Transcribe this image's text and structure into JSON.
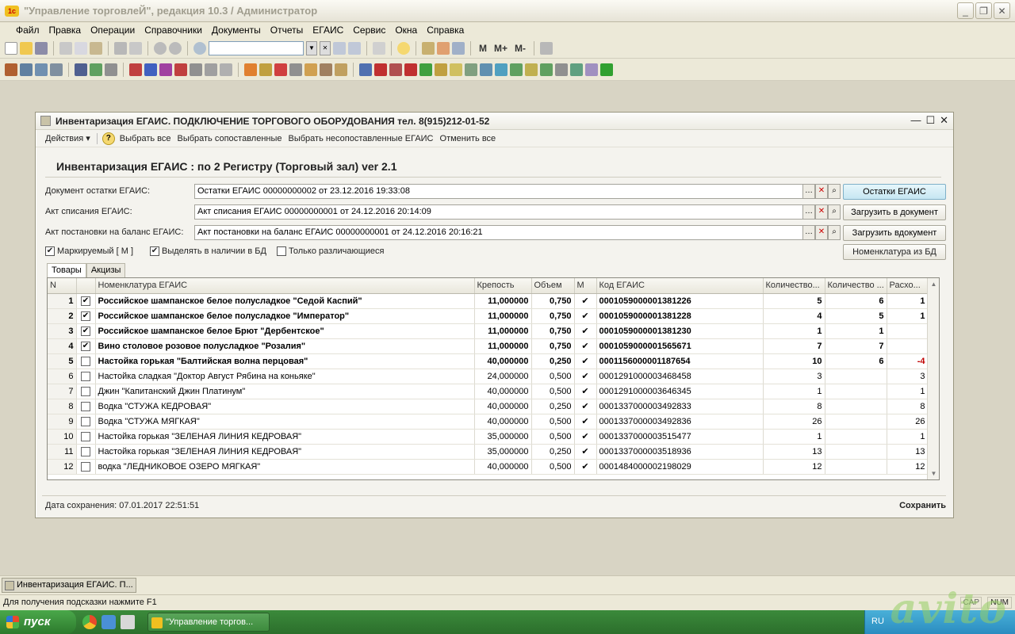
{
  "app": {
    "title": "\"Управление торговлеЙ\", редакция 10.3 / Администратор",
    "menu": [
      "Файл",
      "Правка",
      "Операции",
      "Справочники",
      "Документы",
      "Отчеты",
      "ЕГАИС",
      "Сервис",
      "Окна",
      "Справка"
    ],
    "toolbar_texts": [
      "M",
      "M+",
      "M-"
    ]
  },
  "doc": {
    "window_title": "Инвентаризация ЕГАИС. ПОДКЛЮЧЕНИЕ ТОРГОВОГО ОБОРУДОВАНИЯ тел. 8(915)212-01-52",
    "actions": {
      "actions_menu": "Действия ▾",
      "help": "?",
      "select_all": "Выбрать все",
      "select_matched": "Выбрать сопоставленные",
      "select_unmatched": "Выбрать несопоставленные ЕГАИС",
      "cancel_all": "Отменить все"
    },
    "heading": "Инвентаризация ЕГАИС : по 2 Регистру (Торговый зал) ver 2.1",
    "fields": {
      "doc_remainders": {
        "label": "Документ остатки ЕГАИС:",
        "value": "Остатки ЕГАИС 00000000002 от 23.12.2016 19:33:08",
        "button": "Остатки ЕГАИС"
      },
      "writeoff_act": {
        "label": "Акт списания ЕГАИС:",
        "value": "Акт списания ЕГАИС 00000000001 от 24.12.2016 20:14:09",
        "button": "Загрузить в документ"
      },
      "balance_act": {
        "label": "Акт постановки на баланс ЕГАИС:",
        "value": "Акт постановки на баланс ЕГАИС 00000000001 от 24.12.2016 20:16:21",
        "button": "Загрузить вдокумент"
      }
    },
    "checkboxes": {
      "marked": "Маркируемый [ М ]",
      "highlight_db": "Выделять в наличии в БД",
      "only_diff": "Только различающиеся"
    },
    "nomenclature_button": "Номенклатура из БД",
    "tabs": [
      "Товары",
      "Акцизы"
    ],
    "table": {
      "columns": [
        "N",
        "",
        "Номенклатура ЕГАИС",
        "Крепость",
        "Объем",
        "М",
        "Код ЕГАИС",
        "Количество...",
        "Количество ...",
        "Расхо..."
      ],
      "rows": [
        {
          "n": "1",
          "checked": "✔",
          "name": "Российское шампанское белое полусладкое \"Седой Каспий\"",
          "strength": "11,000000",
          "volume": "0,750",
          "m": "✔",
          "code": "0001059000001381226",
          "qty1": "5",
          "qty2": "6",
          "diff": "1",
          "bold": true
        },
        {
          "n": "2",
          "checked": "✔",
          "name": "Российское шампанское белое полусладкое \"Император\"",
          "strength": "11,000000",
          "volume": "0,750",
          "m": "✔",
          "code": "0001059000001381228",
          "qty1": "4",
          "qty2": "5",
          "diff": "1",
          "bold": true
        },
        {
          "n": "3",
          "checked": "✔",
          "name": "Российское шампанское белое Брют \"Дербентское\"",
          "strength": "11,000000",
          "volume": "0,750",
          "m": "✔",
          "code": "0001059000001381230",
          "qty1": "1",
          "qty2": "1",
          "diff": "",
          "bold": true
        },
        {
          "n": "4",
          "checked": "✔",
          "name": "Вино столовое розовое полусладкое \"Розалия\"",
          "strength": "11,000000",
          "volume": "0,750",
          "m": "✔",
          "code": "0001059000001565671",
          "qty1": "7",
          "qty2": "7",
          "diff": "",
          "bold": true
        },
        {
          "n": "5",
          "checked": "",
          "name": "Настойка горькая \"Балтийская волна перцовая\"",
          "strength": "40,000000",
          "volume": "0,250",
          "m": "✔",
          "code": "0001156000001187654",
          "qty1": "10",
          "qty2": "6",
          "diff": "-4",
          "bold": true
        },
        {
          "n": "6",
          "checked": "",
          "name": "Настойка сладкая \"Доктор Август Рябина на коньяке\"",
          "strength": "24,000000",
          "volume": "0,500",
          "m": "✔",
          "code": "0001291000003468458",
          "qty1": "3",
          "qty2": "",
          "diff": "3",
          "bold": false
        },
        {
          "n": "7",
          "checked": "",
          "name": "Джин \"Капитанский Джин Платинум\"",
          "strength": "40,000000",
          "volume": "0,500",
          "m": "✔",
          "code": "0001291000003646345",
          "qty1": "1",
          "qty2": "",
          "diff": "1",
          "bold": false
        },
        {
          "n": "8",
          "checked": "",
          "name": "Водка \"СТУЖА КЕДРОВАЯ\"",
          "strength": "40,000000",
          "volume": "0,250",
          "m": "✔",
          "code": "0001337000003492833",
          "qty1": "8",
          "qty2": "",
          "diff": "8",
          "bold": false
        },
        {
          "n": "9",
          "checked": "",
          "name": "Водка \"СТУЖА МЯГКАЯ\"",
          "strength": "40,000000",
          "volume": "0,500",
          "m": "✔",
          "code": "0001337000003492836",
          "qty1": "26",
          "qty2": "",
          "diff": "26",
          "bold": false
        },
        {
          "n": "10",
          "checked": "",
          "name": "Настойка горькая \"ЗЕЛЕНАЯ ЛИНИЯ КЕДРОВАЯ\"",
          "strength": "35,000000",
          "volume": "0,500",
          "m": "✔",
          "code": "0001337000003515477",
          "qty1": "1",
          "qty2": "",
          "diff": "1",
          "bold": false
        },
        {
          "n": "11",
          "checked": "",
          "name": "Настойка горькая \"ЗЕЛЕНАЯ ЛИНИЯ КЕДРОВАЯ\"",
          "strength": "35,000000",
          "volume": "0,250",
          "m": "✔",
          "code": "0001337000003518936",
          "qty1": "13",
          "qty2": "",
          "diff": "13",
          "bold": false
        },
        {
          "n": "12",
          "checked": "",
          "name": "водка \"ЛЕДНИКОВОЕ ОЗЕРО МЯГКАЯ\"",
          "strength": "40,000000",
          "volume": "0,500",
          "m": "✔",
          "code": "0001484000002198029",
          "qty1": "12",
          "qty2": "",
          "diff": "12",
          "bold": false
        }
      ]
    },
    "save_date": "Дата сохранения:   07.01.2017 22:51:51",
    "save_button": "Сохранить"
  },
  "window_list": {
    "item": "Инвентаризация ЕГАИС. П..."
  },
  "status": {
    "hint": "Для получения подсказки нажмите F1",
    "cap": "CAP",
    "num": "NUM"
  },
  "taskbar": {
    "start": "пуск",
    "item": "\"Управление торгов...",
    "lang": "RU"
  },
  "watermark": "avito",
  "colors": {
    "negative": "#c00000",
    "hot_button": "#c6e6f2",
    "taskbar": "#2c6f2c"
  }
}
